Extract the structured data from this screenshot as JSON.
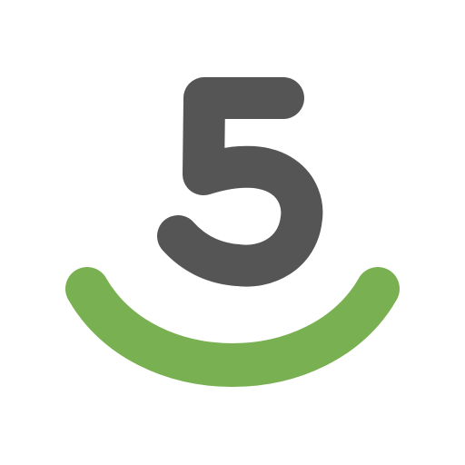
{
  "logo": {
    "digit": "5",
    "icon": "five-smile-logo-icon",
    "colors": {
      "digit": "#555555",
      "smile": "#79b152",
      "background": "#ffffff"
    }
  }
}
